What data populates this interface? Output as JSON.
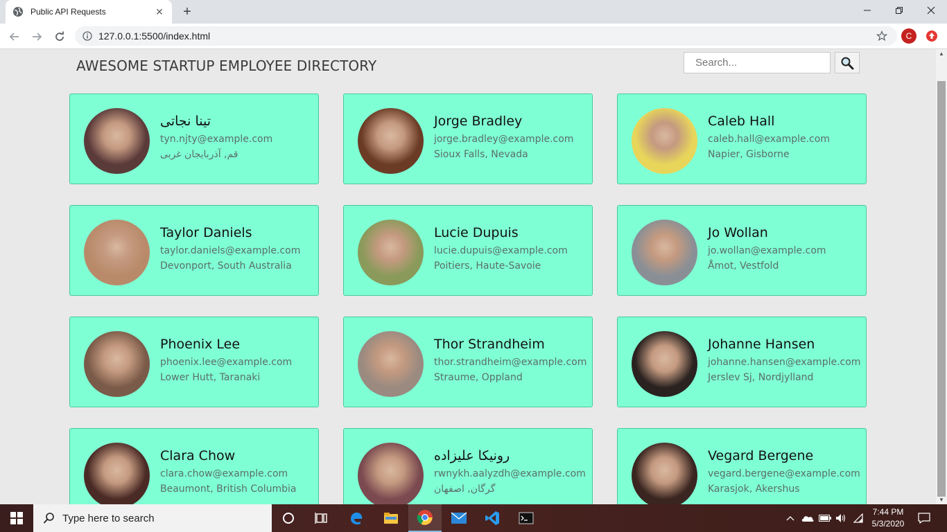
{
  "browser": {
    "tab_title": "Public API Requests",
    "tab_close": "✕",
    "new_tab": "+",
    "url": "127.0.0.1:5500/index.html",
    "profile_initial": "C"
  },
  "page": {
    "title": "AWESOME STARTUP EMPLOYEE DIRECTORY",
    "search_placeholder": "Search..."
  },
  "employees": [
    {
      "name": "تینا نجاتی",
      "email": "tyn.njty@example.com",
      "location": "قم, آذربایجان غربی",
      "avatar_color": "#5b3a3a"
    },
    {
      "name": "Jorge Bradley",
      "email": "jorge.bradley@example.com",
      "location": "Sioux Falls, Nevada",
      "avatar_color": "#6b3b25"
    },
    {
      "name": "Caleb Hall",
      "email": "caleb.hall@example.com",
      "location": "Napier, Gisborne",
      "avatar_color": "#e8d65a"
    },
    {
      "name": "Taylor Daniels",
      "email": "taylor.daniels@example.com",
      "location": "Devonport, South Australia",
      "avatar_color": "#b98a6a"
    },
    {
      "name": "Lucie Dupuis",
      "email": "lucie.dupuis@example.com",
      "location": "Poitiers, Haute-Savoie",
      "avatar_color": "#8a9a5a"
    },
    {
      "name": "Jo Wollan",
      "email": "jo.wollan@example.com",
      "location": "Åmot, Vestfold",
      "avatar_color": "#8a8f95"
    },
    {
      "name": "Phoenix Lee",
      "email": "phoenix.lee@example.com",
      "location": "Lower Hutt, Taranaki",
      "avatar_color": "#7a5a48"
    },
    {
      "name": "Thor Strandheim",
      "email": "thor.strandheim@example.com",
      "location": "Straume, Oppland",
      "avatar_color": "#9a8a80"
    },
    {
      "name": "Johanne Hansen",
      "email": "johanne.hansen@example.com",
      "location": "Jerslev Sj, Nordjylland",
      "avatar_color": "#2a2220"
    },
    {
      "name": "Clara Chow",
      "email": "clara.chow@example.com",
      "location": "Beaumont, British Columbia",
      "avatar_color": "#4a2a25"
    },
    {
      "name": "رونیکا علیزاده",
      "email": "rwnykh.aalyzdh@example.com",
      "location": "گرگان, اصفهان",
      "avatar_color": "#7a4a50"
    },
    {
      "name": "Vegard Bergene",
      "email": "vegard.bergene@example.com",
      "location": "Karasjok, Akershus",
      "avatar_color": "#3a2520"
    }
  ],
  "taskbar": {
    "search_label": "Type here to search",
    "time": "7:44 PM",
    "date": "5/3/2020"
  }
}
